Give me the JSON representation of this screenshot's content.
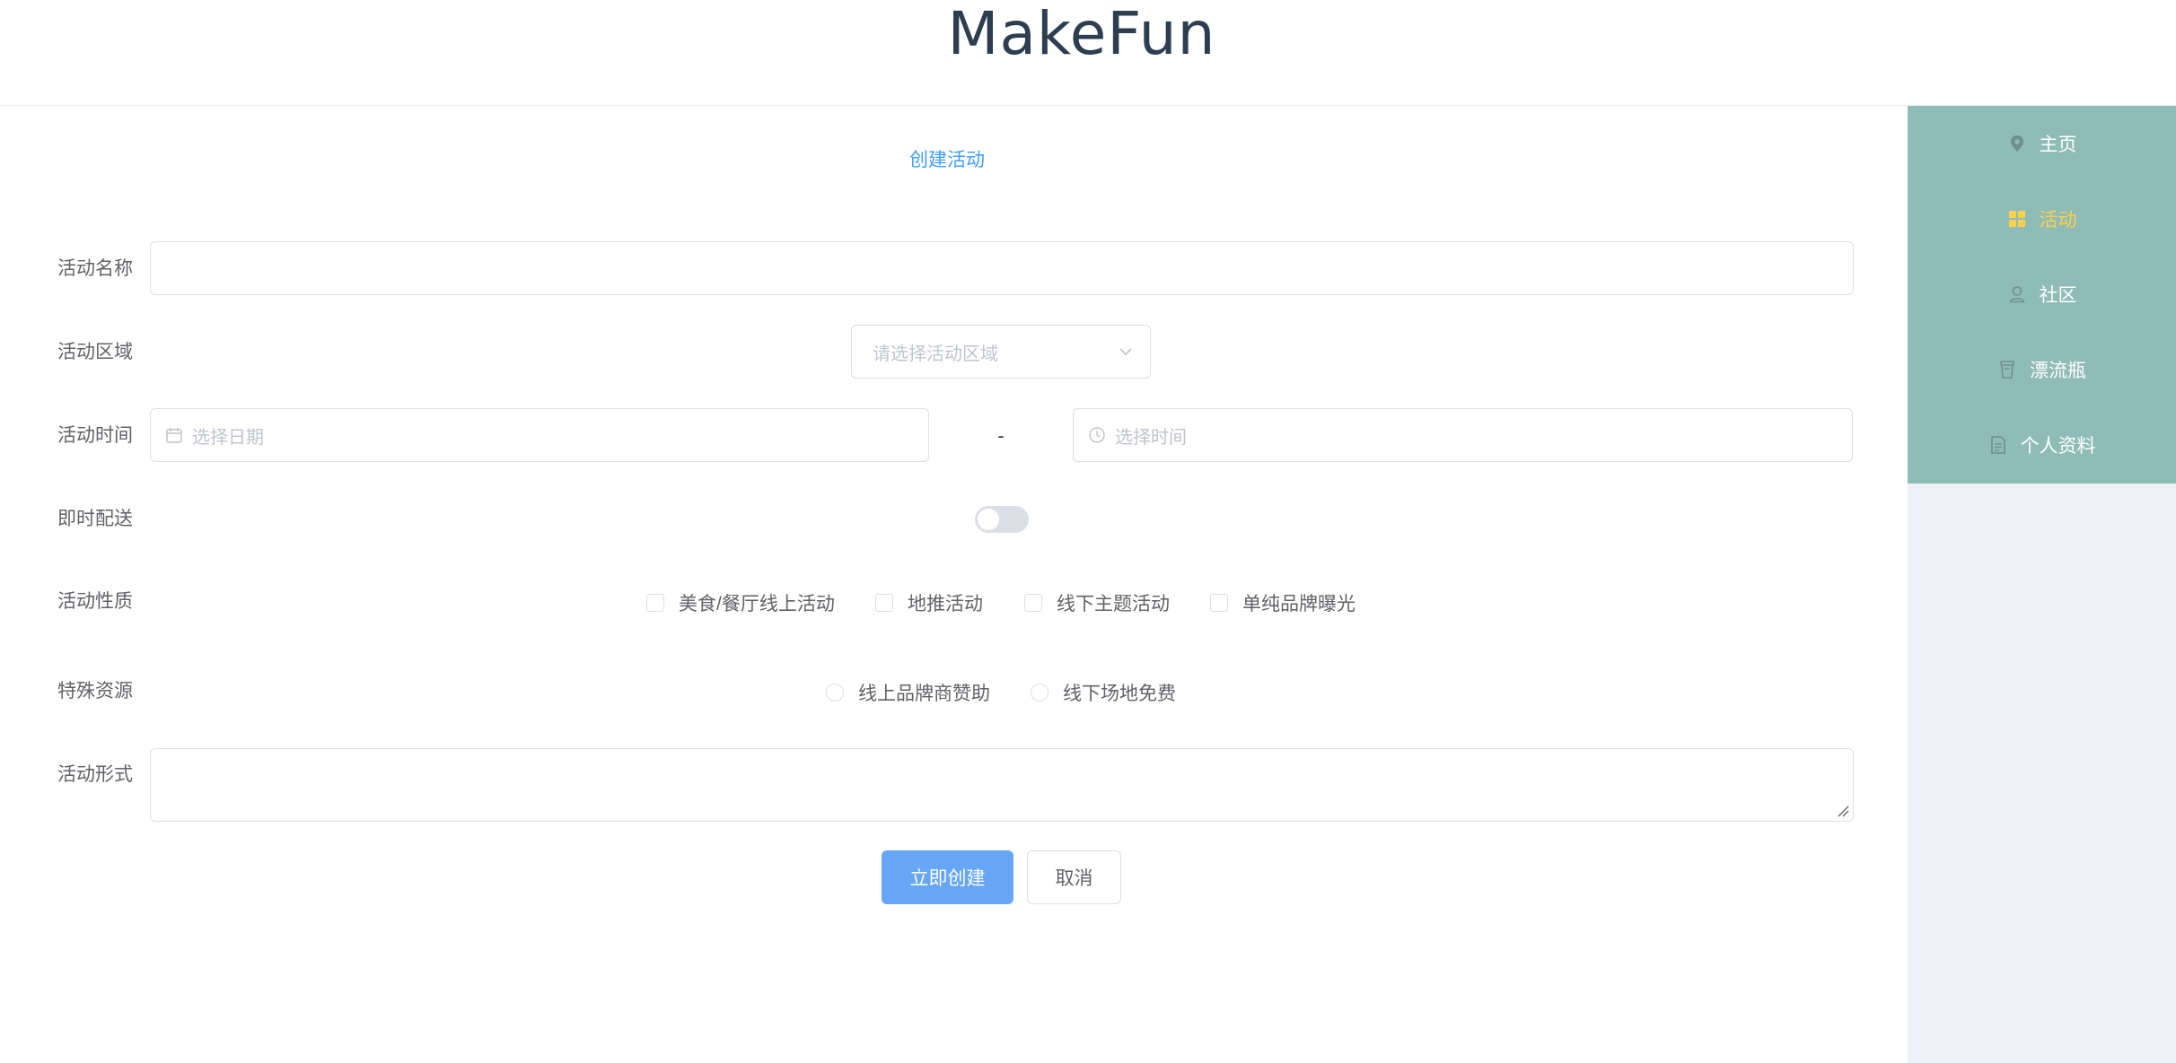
{
  "header": {
    "brand": "MakeFun"
  },
  "sidebar": {
    "items": [
      {
        "label": "主页",
        "icon": "location-icon",
        "active": false
      },
      {
        "label": "活动",
        "icon": "grid-icon",
        "active": true
      },
      {
        "label": "社区",
        "icon": "user-icon",
        "active": false
      },
      {
        "label": "漂流瓶",
        "icon": "bottle-icon",
        "active": false
      },
      {
        "label": "个人资料",
        "icon": "document-icon",
        "active": false
      }
    ],
    "accent_color": "#8fbcb7",
    "active_color": "#ffd04b"
  },
  "form": {
    "title": "创建活动",
    "name": {
      "label": "活动名称",
      "value": ""
    },
    "region": {
      "label": "活动区域",
      "placeholder": "请选择活动区域"
    },
    "time": {
      "label": "活动时间",
      "date_placeholder": "选择日期",
      "separator": "-",
      "time_placeholder": "选择时间"
    },
    "instant": {
      "label": "即时配送",
      "on": false
    },
    "nature": {
      "label": "活动性质",
      "options": [
        "美食/餐厅线上活动",
        "地推活动",
        "线下主题活动",
        "单纯品牌曝光"
      ]
    },
    "resource": {
      "label": "特殊资源",
      "options": [
        "线上品牌商赞助",
        "线下场地免费"
      ]
    },
    "format": {
      "label": "活动形式",
      "value": ""
    },
    "submit_label": "立即创建",
    "cancel_label": "取消",
    "primary_color": "#409eff"
  }
}
